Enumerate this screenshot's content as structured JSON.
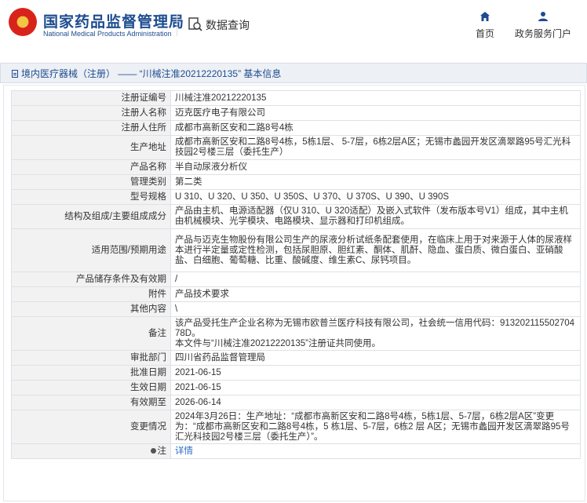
{
  "header": {
    "title": "国家药品监督管理局",
    "subtitle": "National Medical Products Administration",
    "data_query": "数据查询",
    "nav": [
      {
        "label": "首页",
        "icon": "home-icon"
      },
      {
        "label": "政务服务门户",
        "icon": "user-icon"
      }
    ]
  },
  "breadcrumb": "境内医疗器械（注册） —— “川械注准20212220135” 基本信息",
  "rows": [
    {
      "label": "注册证编号",
      "value": "川械注准20212220135"
    },
    {
      "label": "注册人名称",
      "value": "迈克医疗电子有限公司"
    },
    {
      "label": "注册人住所",
      "value": "成都市高新区安和二路8号4栋"
    },
    {
      "label": "生产地址",
      "value": "成都市高新区安和二路8号4栋，5栋1层、 5-7层，6栋2层A区；无锡市蠡园开发区滴翠路95号汇光科技园2号楼三层（委托生产）"
    },
    {
      "label": "产品名称",
      "value": "半自动尿液分析仪"
    },
    {
      "label": "管理类别",
      "value": "第二类"
    },
    {
      "label": "型号规格",
      "value": "U 310、U 320、U 350、U 350S、U 370、U 370S、U 390、U 390S"
    },
    {
      "label": "结构及组成/主要组成成分",
      "value": "产品由主机、电源适配器（仅U 310、U 320适配）及嵌入式软件（发布版本号V1）组成，其中主机由机械模块、光学模块、电路模块、显示器和打印机组成。"
    },
    {
      "label": "适用范围/预期用途",
      "value": "产品与迈克生物股份有限公司生产的尿液分析试纸条配套使用，在临床上用于对来源于人体的尿液样本进行半定量或定性检测，包括尿胆原、胆红素、酮体、肌酐、隐血、蛋白质、微白蛋白、亚硝酸盐、白细胞、葡萄糖、比重、酸碱度、维生素C、尿钙项目。"
    },
    {
      "label": "产品储存条件及有效期",
      "value": "/"
    },
    {
      "label": "附件",
      "value": "产品技术要求"
    },
    {
      "label": "其他内容",
      "value": "\\"
    },
    {
      "label": "备注",
      "value": "该产品受托生产企业名称为无锡市欧普兰医疗科技有限公司，社会统一信用代码：91320211550270478D。\n本文件与“川械注准20212220135”注册证共同使用。"
    },
    {
      "label": "审批部门",
      "value": "四川省药品监督管理局"
    },
    {
      "label": "批准日期",
      "value": "2021-06-15"
    },
    {
      "label": "生效日期",
      "value": "2021-06-15"
    },
    {
      "label": "有效期至",
      "value": "2026-06-14"
    },
    {
      "label": "变更情况",
      "value": "2024年3月26日：生产地址：“成都市高新区安和二路8号4栋，5栋1层、5-7层，6栋2层A区”变更为：“成都市高新区安和二路8号4栋，5 栋1层、5-7层，6栋2 层 A区；无锡市蠡园开发区滴翠路95号汇光科技园2号楼三层（委托生产）”。"
    }
  ],
  "note": {
    "label": "注",
    "value": "详情"
  }
}
